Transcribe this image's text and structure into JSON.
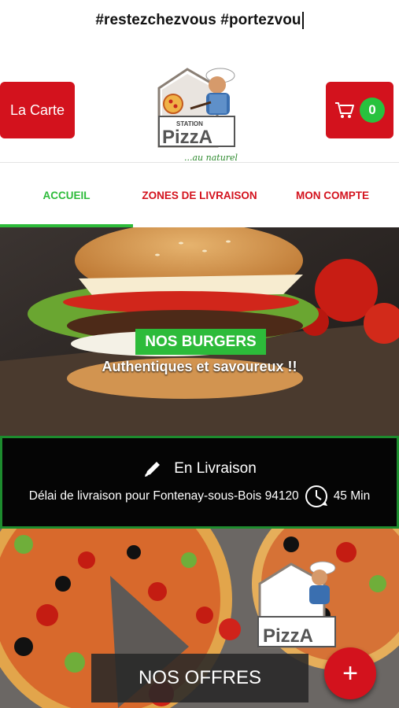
{
  "marquee": {
    "text": "#restezchezvous #portezvou"
  },
  "header": {
    "menu_button_label": "La Carte",
    "cart_count": "0",
    "logo": {
      "brand_top": "STATION",
      "brand_name": "PizzA",
      "tagline": "...au naturel"
    }
  },
  "tabs": [
    {
      "label": "ACCUEIL",
      "active": true
    },
    {
      "label": "ZONES DE LIVRAISON",
      "active": false
    },
    {
      "label": "MON COMPTE",
      "active": false
    }
  ],
  "banner": {
    "badge": "NOS BURGERS",
    "subtitle": "Authentiques et savoureux !!"
  },
  "delivery": {
    "title": "En Livraison",
    "delay_text": "Délai de livraison pour Fontenay-sous-Bois 94120",
    "time": "45 Min"
  },
  "offers": {
    "button_label": "NOS OFFRES",
    "fab_label": "+"
  },
  "colors": {
    "primary_red": "#d3121d",
    "accent_green": "#2dbb3a",
    "dark": "#050505"
  }
}
